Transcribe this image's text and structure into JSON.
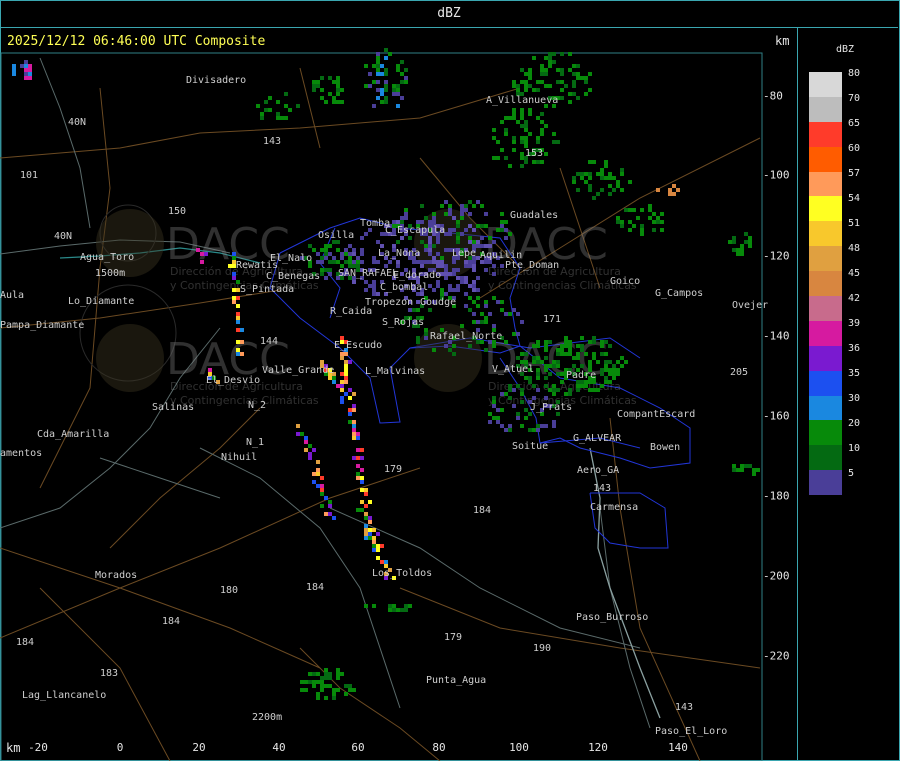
{
  "header": {
    "title": "dBZ"
  },
  "map": {
    "timestamp": "2025/12/12 06:46:00 UTC Composite",
    "unit_top": "km",
    "unit_bottom": "km",
    "x_ticks": [
      "-20",
      "0",
      "20",
      "40",
      "60",
      "80",
      "100",
      "120",
      "140"
    ],
    "y_ticks": [
      "-80",
      "-100",
      "-120",
      "-140",
      "-160",
      "-180",
      "-200",
      "-220"
    ],
    "places": [
      {
        "name": "Divisadero"
      },
      {
        "name": "A_Villanueva"
      },
      {
        "name": "40N"
      },
      {
        "name": "101"
      },
      {
        "name": "143"
      },
      {
        "name": "153"
      },
      {
        "name": "150"
      },
      {
        "name": "Guadales"
      },
      {
        "name": "Tomba"
      },
      {
        "name": "Osilla"
      },
      {
        "name": "C_Escapula"
      },
      {
        "name": "La_Nona"
      },
      {
        "name": "Lepe"
      },
      {
        "name": "Aquilin"
      },
      {
        "name": "40N"
      },
      {
        "name": "Agua_Toro"
      },
      {
        "name": "1500m"
      },
      {
        "name": "Lo_Diamante"
      },
      {
        "name": "Aula"
      },
      {
        "name": "Pampa_Diamante"
      },
      {
        "name": "Rewatis"
      },
      {
        "name": "El_Nalo"
      },
      {
        "name": "C_Benegas"
      },
      {
        "name": "SAN_RAFAEL"
      },
      {
        "name": "E_dorado"
      },
      {
        "name": "C_bombal"
      },
      {
        "name": "Pte_Doman"
      },
      {
        "name": "Goico"
      },
      {
        "name": "G_Campos"
      },
      {
        "name": "Ovejer"
      },
      {
        "name": "S_Pintada"
      },
      {
        "name": "Tropezon"
      },
      {
        "name": "Goudge"
      },
      {
        "name": "R_Caida"
      },
      {
        "name": "S_Rojas"
      },
      {
        "name": "171"
      },
      {
        "name": "Rafael_Norte"
      },
      {
        "name": "144"
      },
      {
        "name": "E_Escudo"
      },
      {
        "name": "Valle_Grande"
      },
      {
        "name": "L_Malvinas"
      },
      {
        "name": "V_Atuel"
      },
      {
        "name": "Padre"
      },
      {
        "name": "205"
      },
      {
        "name": "El_Desvio"
      },
      {
        "name": "Salinas"
      },
      {
        "name": "N_2"
      },
      {
        "name": "J_Prats"
      },
      {
        "name": "CompantEscard"
      },
      {
        "name": "Cda_Amarilla"
      },
      {
        "name": "N_1"
      },
      {
        "name": "G_ALVEAR"
      },
      {
        "name": "Bowen"
      },
      {
        "name": "amentos"
      },
      {
        "name": "Nihuil"
      },
      {
        "name": "Soitue"
      },
      {
        "name": "Aero_GA"
      },
      {
        "name": "179"
      },
      {
        "name": "184"
      },
      {
        "name": "143"
      },
      {
        "name": "Carmensa"
      },
      {
        "name": "Morados"
      },
      {
        "name": "Los_Toldos"
      },
      {
        "name": "180"
      },
      {
        "name": "184"
      },
      {
        "name": "184"
      },
      {
        "name": "179"
      },
      {
        "name": "190"
      },
      {
        "name": "Paso_Burroso"
      },
      {
        "name": "184"
      },
      {
        "name": "183"
      },
      {
        "name": "Punta_Agua"
      },
      {
        "name": "Lag_Llancanelo"
      },
      {
        "name": "2200m"
      },
      {
        "name": "143"
      },
      {
        "name": "Paso_El_Loro"
      }
    ],
    "watermark": {
      "brand": "DACC",
      "line1": "Dirección de Agricultura",
      "line2": "y Contingencias Climáticas"
    }
  },
  "legend": {
    "title": "dBZ",
    "levels": [
      {
        "label": "80",
        "color": "#d8d8d8"
      },
      {
        "label": "70",
        "color": "#bdbdbd"
      },
      {
        "label": "65",
        "color": "#ff3b2a"
      },
      {
        "label": "60",
        "color": "#ff5c00"
      },
      {
        "label": "57",
        "color": "#ff9a5a"
      },
      {
        "label": "54",
        "color": "#ffff22"
      },
      {
        "label": "51",
        "color": "#f8c82c"
      },
      {
        "label": "48",
        "color": "#e0a040"
      },
      {
        "label": "45",
        "color": "#d88640"
      },
      {
        "label": "42",
        "color": "#c86b8c"
      },
      {
        "label": "39",
        "color": "#d61aa0"
      },
      {
        "label": "36",
        "color": "#7a1ad0"
      },
      {
        "label": "35",
        "color": "#1c50f0"
      },
      {
        "label": "30",
        "color": "#1a88e0"
      },
      {
        "label": "20",
        "color": "#078a0a"
      },
      {
        "label": "10",
        "color": "#046a12"
      },
      {
        "label": "5",
        "color": "#4a3e98"
      }
    ]
  }
}
